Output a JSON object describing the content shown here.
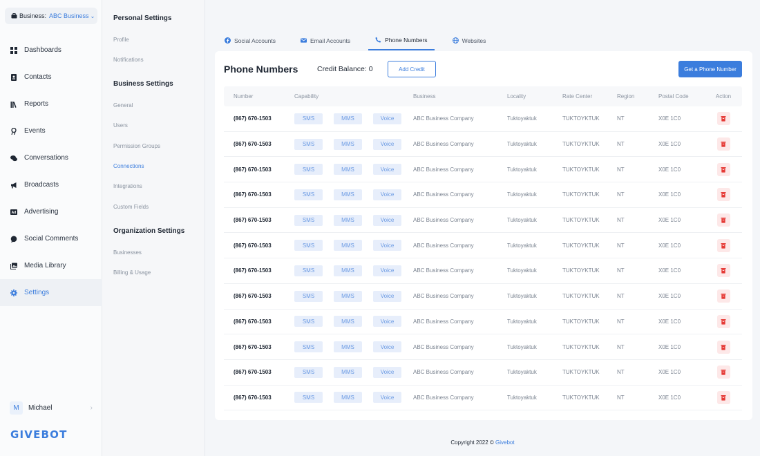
{
  "business_switcher": {
    "label": "Business:",
    "value": "ABC Business"
  },
  "nav": [
    {
      "label": "Dashboards",
      "icon": "grid-icon"
    },
    {
      "label": "Contacts",
      "icon": "contact-card-icon"
    },
    {
      "label": "Reports",
      "icon": "library-icon"
    },
    {
      "label": "Events",
      "icon": "pin-icon"
    },
    {
      "label": "Conversations",
      "icon": "chat-bubbles-icon"
    },
    {
      "label": "Broadcasts",
      "icon": "megaphone-icon"
    },
    {
      "label": "Advertising",
      "icon": "ad-icon"
    },
    {
      "label": "Social Comments",
      "icon": "comment-icon"
    },
    {
      "label": "Media Library",
      "icon": "media-icon"
    },
    {
      "label": "Settings",
      "icon": "gear-icon",
      "active": true
    }
  ],
  "user": {
    "initial": "M",
    "name": "Michael"
  },
  "logo": "GIVEBOT",
  "settings": {
    "personal_title": "Personal Settings",
    "personal": [
      "Profile",
      "Notifications"
    ],
    "business_title": "Business Settings",
    "business": [
      "General",
      "Users",
      "Permission Groups",
      "Connections",
      "Integrations",
      "Custom Fields"
    ],
    "org_title": "Organization Settings",
    "org": [
      "Businesses",
      "Billing & Usage"
    ],
    "active": "Connections"
  },
  "tabs": [
    {
      "label": "Social Accounts",
      "icon": "facebook-icon"
    },
    {
      "label": "Email Accounts",
      "icon": "mail-icon"
    },
    {
      "label": "Phone Numbers",
      "icon": "phone-icon",
      "active": true
    },
    {
      "label": "Websites",
      "icon": "globe-icon"
    }
  ],
  "page": {
    "title": "Phone Numbers",
    "credit_balance": "Credit Balance: 0",
    "add_credit": "Add Credit",
    "get_number": "Get a Phone Number"
  },
  "table": {
    "headers": [
      "Number",
      "Capability",
      "Business",
      "Locality",
      "Rate Center",
      "Region",
      "Postal Code",
      "Action"
    ],
    "rows": [
      {
        "number": "(867) 670-1503",
        "capabilities": [
          "SMS",
          "MMS",
          "Voice"
        ],
        "business": "ABC Business Company",
        "locality": "Tuktoyaktuk",
        "rate_center": "TUKTOYKTUK",
        "region": "NT",
        "postal": "X0E 1C0"
      },
      {
        "number": "(867) 670-1503",
        "capabilities": [
          "SMS",
          "MMS",
          "Voice"
        ],
        "business": "ABC Business Company",
        "locality": "Tuktoyaktuk",
        "rate_center": "TUKTOYKTUK",
        "region": "NT",
        "postal": "X0E 1C0"
      },
      {
        "number": "(867) 670-1503",
        "capabilities": [
          "SMS",
          "MMS",
          "Voice"
        ],
        "business": "ABC Business Company",
        "locality": "Tuktoyaktuk",
        "rate_center": "TUKTOYKTUK",
        "region": "NT",
        "postal": "X0E 1C0"
      },
      {
        "number": "(867) 670-1503",
        "capabilities": [
          "SMS",
          "MMS",
          "Voice"
        ],
        "business": "ABC Business Company",
        "locality": "Tuktoyaktuk",
        "rate_center": "TUKTOYKTUK",
        "region": "NT",
        "postal": "X0E 1C0"
      },
      {
        "number": "(867) 670-1503",
        "capabilities": [
          "SMS",
          "MMS",
          "Voice"
        ],
        "business": "ABC Business Company",
        "locality": "Tuktoyaktuk",
        "rate_center": "TUKTOYKTUK",
        "region": "NT",
        "postal": "X0E 1C0"
      },
      {
        "number": "(867) 670-1503",
        "capabilities": [
          "SMS",
          "MMS",
          "Voice"
        ],
        "business": "ABC Business Company",
        "locality": "Tuktoyaktuk",
        "rate_center": "TUKTOYKTUK",
        "region": "NT",
        "postal": "X0E 1C0"
      },
      {
        "number": "(867) 670-1503",
        "capabilities": [
          "SMS",
          "MMS",
          "Voice"
        ],
        "business": "ABC Business Company",
        "locality": "Tuktoyaktuk",
        "rate_center": "TUKTOYKTUK",
        "region": "NT",
        "postal": "X0E 1C0"
      },
      {
        "number": "(867) 670-1503",
        "capabilities": [
          "SMS",
          "MMS",
          "Voice"
        ],
        "business": "ABC Business Company",
        "locality": "Tuktoyaktuk",
        "rate_center": "TUKTOYKTUK",
        "region": "NT",
        "postal": "X0E 1C0"
      },
      {
        "number": "(867) 670-1503",
        "capabilities": [
          "SMS",
          "MMS",
          "Voice"
        ],
        "business": "ABC Business Company",
        "locality": "Tuktoyaktuk",
        "rate_center": "TUKTOYKTUK",
        "region": "NT",
        "postal": "X0E 1C0"
      },
      {
        "number": "(867) 670-1503",
        "capabilities": [
          "SMS",
          "MMS",
          "Voice"
        ],
        "business": "ABC Business Company",
        "locality": "Tuktoyaktuk",
        "rate_center": "TUKTOYKTUK",
        "region": "NT",
        "postal": "X0E 1C0"
      },
      {
        "number": "(867) 670-1503",
        "capabilities": [
          "SMS",
          "MMS",
          "Voice"
        ],
        "business": "ABC Business Company",
        "locality": "Tuktoyaktuk",
        "rate_center": "TUKTOYKTUK",
        "region": "NT",
        "postal": "X0E 1C0"
      },
      {
        "number": "(867) 670-1503",
        "capabilities": [
          "SMS",
          "MMS",
          "Voice"
        ],
        "business": "ABC Business Company",
        "locality": "Tuktoyaktuk",
        "rate_center": "TUKTOYKTUK",
        "region": "NT",
        "postal": "X0E 1C0"
      }
    ]
  },
  "footer": {
    "text": "Copyright 2022 © ",
    "brand": "Givebot"
  },
  "colors": {
    "accent": "#3b7ddd",
    "danger": "#e53935",
    "pill_bg": "#e7eefb"
  }
}
